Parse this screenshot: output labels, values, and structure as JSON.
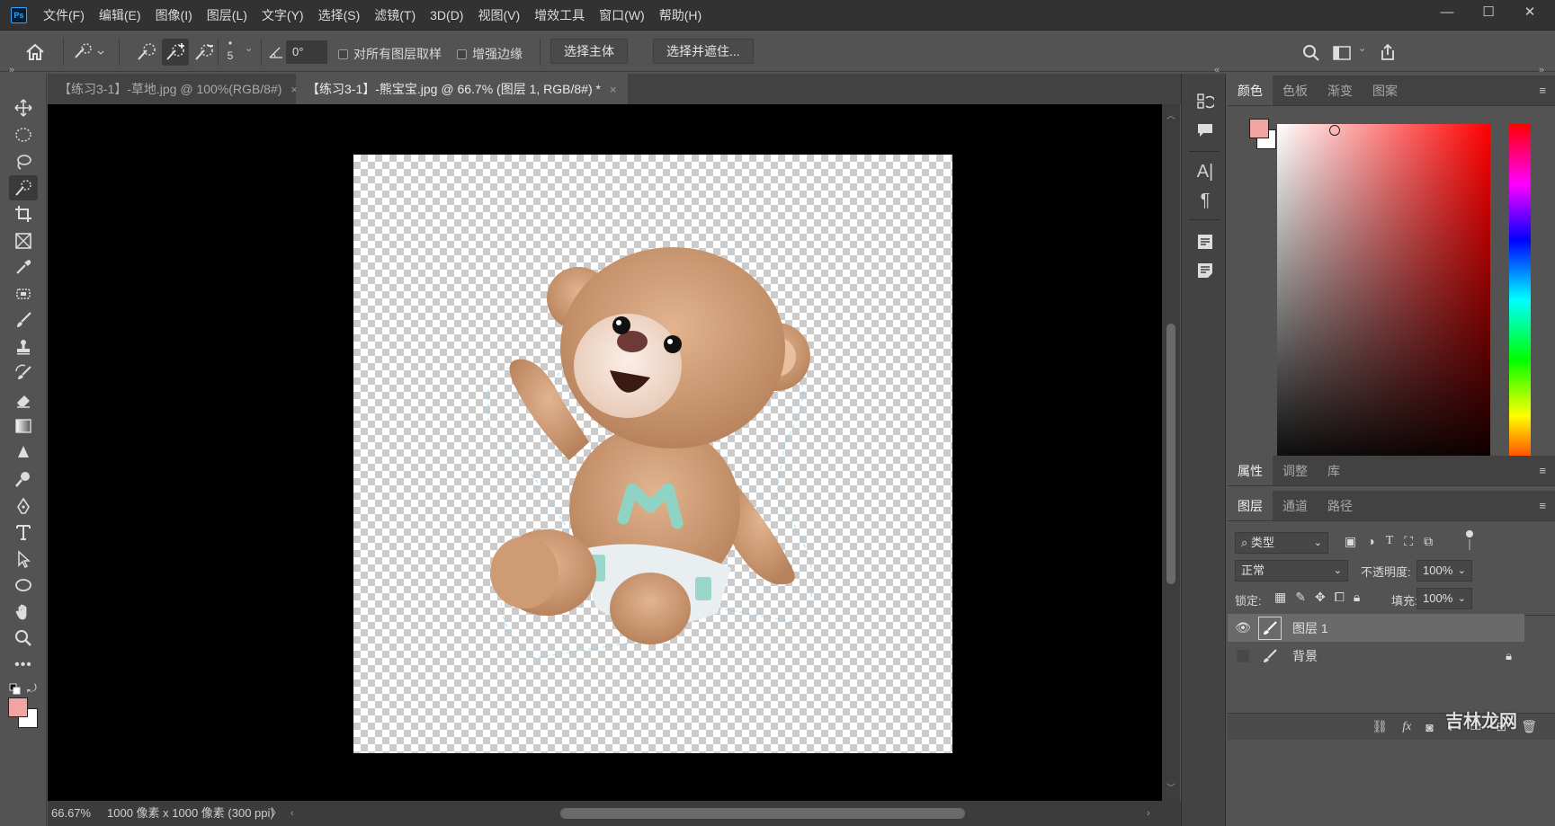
{
  "app": {
    "logo_text": "Ps"
  },
  "menu": [
    "文件(F)",
    "编辑(E)",
    "图像(I)",
    "图层(L)",
    "文字(Y)",
    "选择(S)",
    "滤镜(T)",
    "3D(D)",
    "视图(V)",
    "增效工具",
    "窗口(W)",
    "帮助(H)"
  ],
  "window_controls": {
    "minimize": "—",
    "maximize": "☐",
    "close": "✕"
  },
  "options": {
    "brush_size": "5",
    "angle": "0°",
    "sample_all_layers": "对所有图层取样",
    "enhance_edge": "增强边缘",
    "select_subject": "选择主体",
    "select_and_mask": "选择并遮住..."
  },
  "tabs": [
    {
      "label": "【练习3-1】-草地.jpg @ 100%(RGB/8#)",
      "close": "×",
      "active": false
    },
    {
      "label": "【练习3-1】-熊宝宝.jpg @ 66.7% (图层 1, RGB/8#) *",
      "close": "×",
      "active": true
    }
  ],
  "status": {
    "zoom": "66.67%",
    "doc_size": "1000 像素 x 1000 像素 (300 ppi)",
    "arrow": "〉"
  },
  "color_panel": {
    "tabs": [
      "颜色",
      "色板",
      "渐变",
      "图案"
    ],
    "active_tab": "颜色",
    "foreground": "#f4a3a3",
    "background": "#ffffff",
    "picker_hue": "#ff0000"
  },
  "properties_panel": {
    "tabs": [
      "属性",
      "调整",
      "库"
    ],
    "active_tab": "属性"
  },
  "layers_panel": {
    "tabs": [
      "图层",
      "通道",
      "路径"
    ],
    "active_tab": "图层",
    "filter_kind": "类型",
    "blend_mode": "正常",
    "opacity_label": "不透明度:",
    "opacity": "100%",
    "lock_label": "锁定:",
    "fill_label": "填充:",
    "fill": "100%",
    "layers": [
      {
        "name": "图层 1",
        "visible": true,
        "selected": true,
        "locked": false
      },
      {
        "name": "背景",
        "visible": false,
        "selected": false,
        "locked": true
      }
    ],
    "footer_fx": "fx"
  },
  "watermark": "吉林龙网",
  "accent": {
    "selection": "#31a8ff",
    "panel_bg": "#535353",
    "canvas_bg": "#000000"
  }
}
